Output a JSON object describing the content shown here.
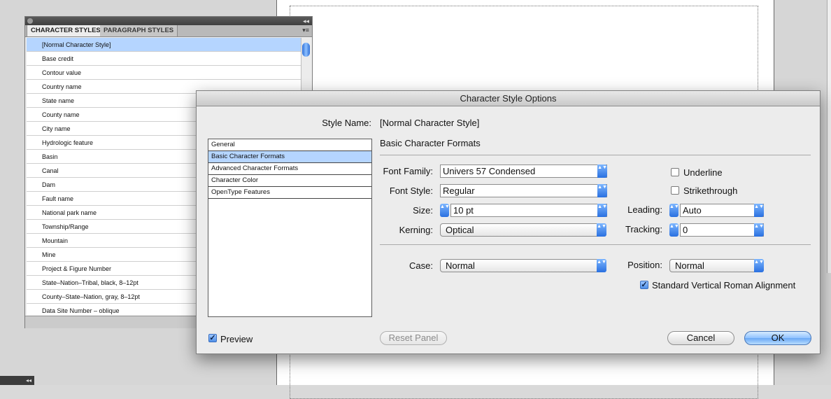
{
  "panel": {
    "tabs": [
      "CHARACTER STYLES",
      "PARAGRAPH STYLES"
    ],
    "collapse_glyph": "◂◂",
    "menu_glyph": "▾≡",
    "styles": [
      "[Normal Character Style]",
      "Base credit",
      "Contour value",
      "Country name",
      "State name",
      "County name",
      "City name",
      "Hydrologic feature",
      "Basin",
      "Canal",
      "Dam",
      "Fault name",
      "National park name",
      "Township/Range",
      "Mountain",
      "Mine",
      "Project & Figure Number",
      "State–Nation–Tribal, black, 8–12pt",
      "County–State–Nation, gray, 8–12pt",
      "Data Site Number – oblique"
    ]
  },
  "bottom_tab_glyph": "◂◂",
  "dialog": {
    "title": "Character Style Options",
    "style_name_label": "Style Name:",
    "style_name_value": "[Normal Character Style]",
    "categories": [
      "General",
      "Basic Character Formats",
      "Advanced Character Formats",
      "Character Color",
      "OpenType Features"
    ],
    "section_title": "Basic Character Formats",
    "font_family": {
      "label": "Font Family:",
      "value": "Univers 57 Condensed"
    },
    "font_style": {
      "label": "Font Style:",
      "value": "Regular"
    },
    "size": {
      "label": "Size:",
      "value": "10 pt"
    },
    "kerning": {
      "label": "Kerning:",
      "value": "Optical"
    },
    "leading": {
      "label": "Leading:",
      "value": "Auto"
    },
    "tracking": {
      "label": "Tracking:",
      "value": "0"
    },
    "underline": {
      "label": "Underline",
      "checked": false
    },
    "strikethrough": {
      "label": "Strikethrough",
      "checked": false
    },
    "case": {
      "label": "Case:",
      "value": "Normal"
    },
    "position": {
      "label": "Position:",
      "value": "Normal"
    },
    "vertical_roman": {
      "label": "Standard Vertical Roman Alignment",
      "checked": true
    },
    "preview": {
      "label": "Preview",
      "checked": true
    },
    "reset_label": "Reset Panel",
    "cancel_label": "Cancel",
    "ok_label": "OK",
    "check_glyph": "✓",
    "arrow_glyph": "▲▼"
  },
  "colors": {
    "accent": "#2a70e0",
    "selection": "#b5d5ff"
  }
}
